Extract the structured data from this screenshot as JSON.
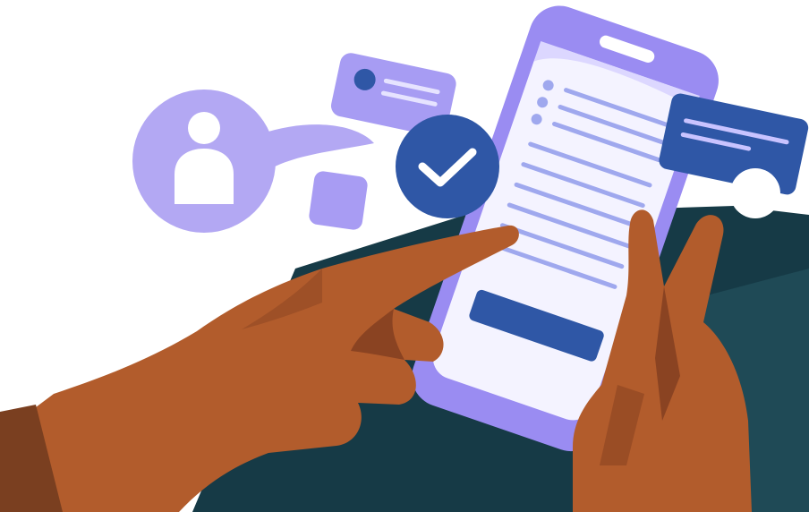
{
  "illustration": {
    "colors": {
      "background": "#ffffff",
      "backdrop_dark": "#163a46",
      "backdrop_mid": "#1f4a56",
      "phone_body": "#9a8cf2",
      "phone_screen": "#f4f3ff",
      "screen_lines": "#9fa8ee",
      "screen_dots": "#9fa8ee",
      "screen_button": "#2f57a6",
      "check_badge": "#2f57a6",
      "check_mark": "#ffffff",
      "avatar_bubble": "#b3a8f3",
      "avatar_figure": "#ffffff",
      "chat_bubble_left": "#a79cf3",
      "chat_bubble_left_dot": "#2f57a6",
      "chat_bubble_left_lines": "#e6e3ff",
      "chat_bubble_right": "#2f57a6",
      "chat_bubble_right_lines": "#c9c3ff",
      "small_square": "#a89cf3",
      "white_circle": "#ffffff",
      "skin": "#b25c2c",
      "skin_shadow": "#8a4322",
      "sleeve": "#7a3f20"
    },
    "icons": [
      "avatar-icon",
      "check-icon"
    ]
  }
}
